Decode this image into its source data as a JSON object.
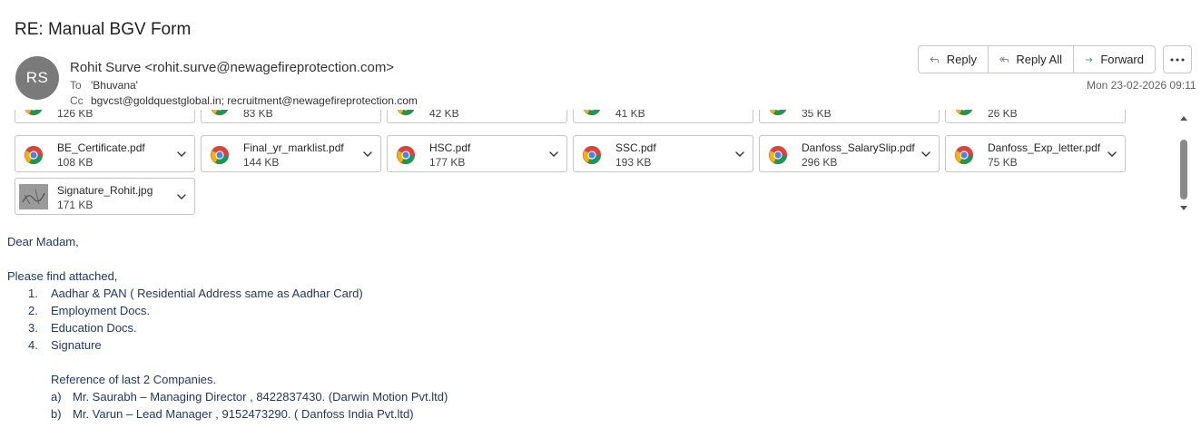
{
  "subject": "RE: Manual BGV Form",
  "sender": {
    "initials": "RS",
    "name_line": "Rohit Surve <rohit.surve@newagefireprotection.com>",
    "to_label": "To",
    "to": "'Bhuvana'",
    "cc_label": "Cc",
    "cc": "bgvcst@goldquestglobal.in; recruitment@newagefireprotection.com"
  },
  "actions": {
    "reply": "Reply",
    "reply_all": "Reply All",
    "forward": "Forward",
    "more": "..."
  },
  "date": "Mon 23-02-2026 09:11",
  "attachments": {
    "row1": [
      {
        "name": "",
        "size": "126 KB"
      },
      {
        "name": "",
        "size": "83 KB"
      },
      {
        "name": "",
        "size": "42 KB"
      },
      {
        "name": "",
        "size": "41 KB"
      },
      {
        "name": "",
        "size": "35 KB"
      },
      {
        "name": "",
        "size": "26 KB"
      }
    ],
    "row2": [
      {
        "name": "BE_Certificate.pdf",
        "size": "108 KB"
      },
      {
        "name": "Final_yr_marklist.pdf",
        "size": "144 KB"
      },
      {
        "name": "HSC.pdf",
        "size": "177 KB"
      },
      {
        "name": "SSC.pdf",
        "size": "193 KB"
      },
      {
        "name": "Danfoss_SalarySlip.pdf",
        "size": "296 KB"
      },
      {
        "name": "Danfoss_Exp_letter.pdf",
        "size": "75 KB"
      }
    ],
    "row3": [
      {
        "name": "Signature_Rohit.jpg",
        "size": "171 KB"
      }
    ]
  },
  "body": {
    "greeting": "Dear Madam,",
    "intro": "Please find attached,",
    "list": [
      {
        "num": "1.",
        "text": "Aadhar & PAN ( Residential Address same as Aadhar Card)"
      },
      {
        "num": "2.",
        "text": "Employment Docs."
      },
      {
        "num": "3.",
        "text": "Education Docs."
      },
      {
        "num": "4.",
        "text": "Signature"
      }
    ],
    "ref_heading": "Reference of last 2 Companies.",
    "refs": [
      {
        "letter": "a)",
        "text": "Mr. Saurabh – Managing Director , 8422837430. (Darwin Motion Pvt.ltd)"
      },
      {
        "letter": "b)",
        "text": "Mr. Varun – Lead Manager , 9152473290. ( Danfoss India Pvt.ltd)"
      }
    ]
  }
}
